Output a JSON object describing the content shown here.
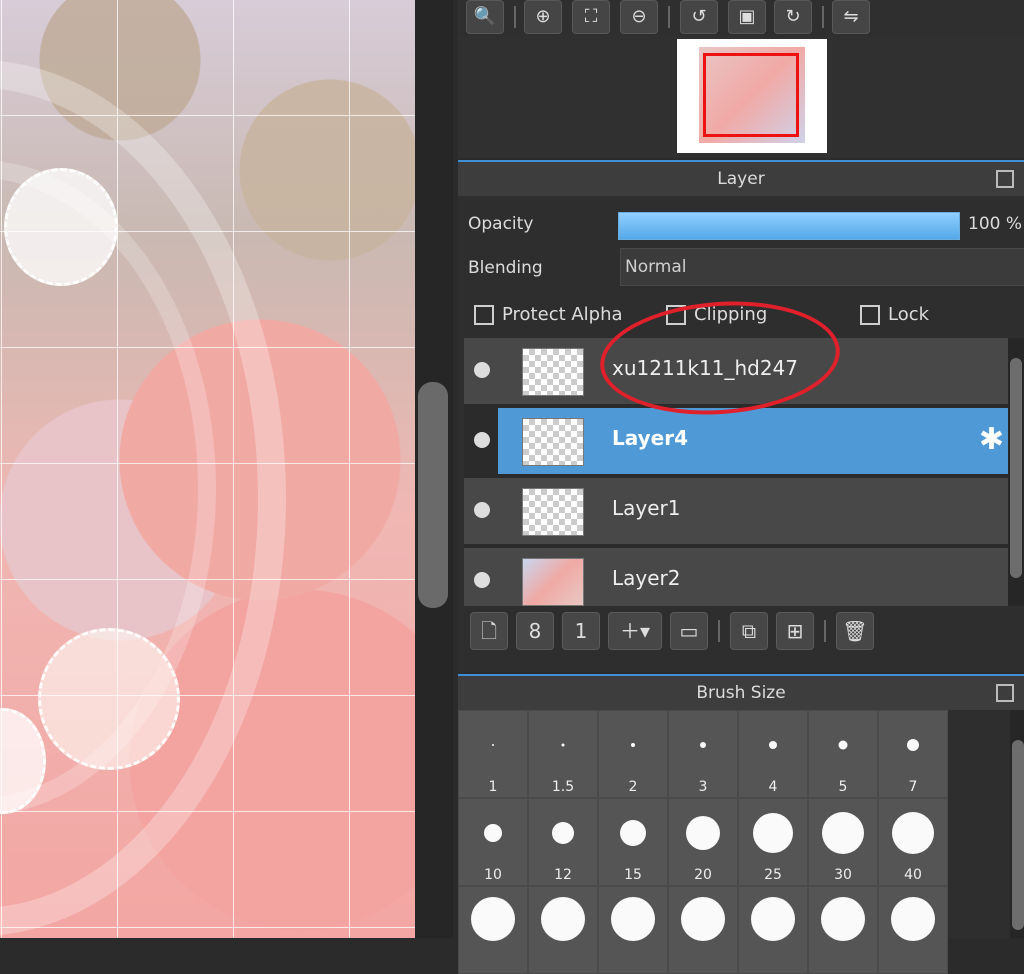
{
  "toolbar": {
    "buttons": [
      {
        "name": "zoom-actual-icon",
        "glyph": "🔍"
      },
      {
        "name": "zoom-in-icon",
        "glyph": "⊕"
      },
      {
        "name": "fit-icon",
        "glyph": "⛶"
      },
      {
        "name": "zoom-out-icon",
        "glyph": "⊖"
      },
      {
        "name": "rotate-left-icon",
        "glyph": "↺"
      },
      {
        "name": "fullscreen-icon",
        "glyph": "▣"
      },
      {
        "name": "rotate-right-icon",
        "glyph": "↻"
      },
      {
        "name": "flip-icon",
        "glyph": "⇋"
      }
    ]
  },
  "layer_panel": {
    "title": "Layer",
    "opacity_label": "Opacity",
    "opacity_value": "100 %",
    "opacity_fraction": 1.0,
    "blending_label": "Blending",
    "blending_value": "Normal",
    "checkboxes": {
      "protect_alpha": "Protect Alpha",
      "clipping": "Clipping",
      "lock": "Lock"
    },
    "layers": [
      {
        "name": "xu1211k11_hd247",
        "selected": false
      },
      {
        "name": "Layer4",
        "selected": true
      },
      {
        "name": "Layer1",
        "selected": false
      },
      {
        "name": "Layer2",
        "selected": false
      }
    ]
  },
  "brush_panel": {
    "title": "Brush Size",
    "sizes_row1": [
      "1",
      "1.5",
      "2",
      "3",
      "4",
      "5",
      "7"
    ],
    "sizes_row2": [
      "10",
      "12",
      "15",
      "20",
      "25",
      "30",
      "40"
    ]
  },
  "colors": {
    "accent": "#4f9ad6",
    "annotation": "#e0202a"
  }
}
